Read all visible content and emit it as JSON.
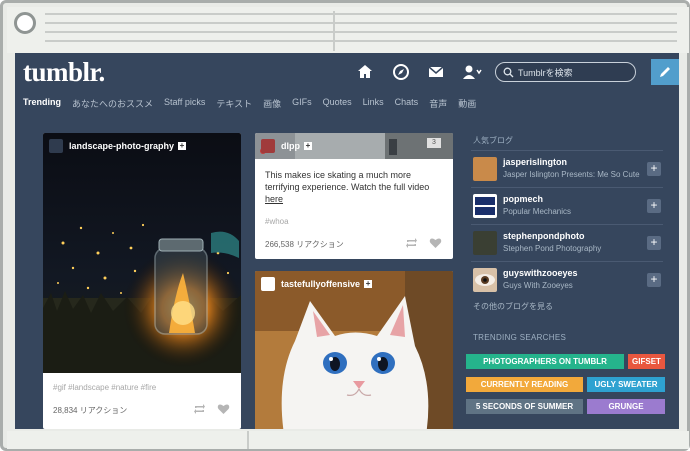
{
  "header": {
    "logo": "tumblr.",
    "search_placeholder": "Tumblrを検索",
    "icons": [
      "home-icon",
      "compass-icon",
      "mail-icon",
      "account-icon",
      "search-icon",
      "pencil-icon"
    ],
    "accent_color": "#529ecc"
  },
  "tabs": [
    "Trending",
    "あなたへのおススメ",
    "Staff picks",
    "テキスト",
    "画像",
    "GIFs",
    "Quotes",
    "Links",
    "Chats",
    "音声",
    "動画"
  ],
  "posts": {
    "landscape": {
      "username": "landscape-photo-graphy",
      "tags": "#gif  #landscape  #nature  #fire",
      "notes": "28,834 リアクション"
    },
    "dlpp": {
      "username": "dlpp",
      "counter": "3",
      "text": "This makes ice skating a much more terrifying experience. Watch the full video",
      "link": "here",
      "tags": "#whoa",
      "notes": "266,538 リアクション"
    },
    "cat": {
      "username": "tastefullyoffensive"
    }
  },
  "sidebar": {
    "popular_title": "人気ブログ",
    "blogs": [
      {
        "name": "jasperislington",
        "subtitle": "Jasper Islington Presents: Me So Cute"
      },
      {
        "name": "popmech",
        "subtitle": "Popular Mechanics"
      },
      {
        "name": "stephenpondphoto",
        "subtitle": "Stephen Pond Photography"
      },
      {
        "name": "guyswithzooeyes",
        "subtitle": "Guys With Zooeyes"
      }
    ],
    "more_link": "その他のブログを見る",
    "trending_title": "TRENDING SEARCHES",
    "searches": [
      {
        "label": "PHOTOGRAPHERS ON TUMBLR",
        "color": "#25b48c"
      },
      {
        "label": "GIFSET",
        "color": "#e9573f"
      },
      {
        "label": "CURRENTLY READING",
        "color": "#f2a93b"
      },
      {
        "label": "UGLY SWEATER",
        "color": "#2ea2d1"
      },
      {
        "label": "5 SECONDS OF SUMMER",
        "color": "#5f7384"
      },
      {
        "label": "GRUNGE",
        "color": "#9b7bcf"
      }
    ]
  }
}
